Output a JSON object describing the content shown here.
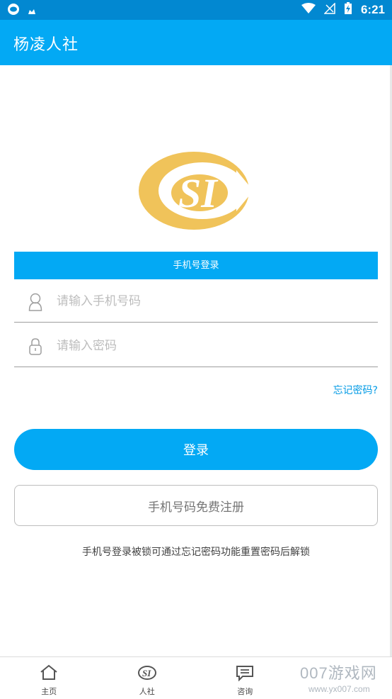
{
  "status_bar": {
    "time": "6:21",
    "icons": [
      "notification-icon",
      "cloud-icon",
      "wifi-icon",
      "no-signal-icon",
      "battery-charging-icon"
    ]
  },
  "app_bar": {
    "title": "杨凌人社"
  },
  "logo": {
    "name": "SI logo",
    "color": "#f0c35a"
  },
  "login_tab": {
    "label": "手机号登录"
  },
  "phone_field": {
    "placeholder": "请输入手机号码",
    "value": "",
    "icon": "user-icon"
  },
  "password_field": {
    "placeholder": "请输入密码",
    "value": "",
    "icon": "lock-icon"
  },
  "forgot_link": {
    "label": "忘记密码?"
  },
  "login_button": {
    "label": "登录"
  },
  "register_button": {
    "label": "手机号码免费注册"
  },
  "hint": {
    "text": "手机号登录被锁可通过忘记密码功能重置密码后解锁"
  },
  "bottom_nav": {
    "items": [
      {
        "label": "主页",
        "icon": "home-icon"
      },
      {
        "label": "人社",
        "icon": "si-logo-icon"
      },
      {
        "label": "咨询",
        "icon": "chat-icon"
      },
      {
        "label": "",
        "icon": ""
      }
    ]
  },
  "watermark": {
    "line1": "007游戏网",
    "line2": "www.yx007.com"
  },
  "colors": {
    "primary": "#03a9f4",
    "status_bar": "#0288d1",
    "link": "#039be5",
    "logo": "#f0c35a"
  }
}
